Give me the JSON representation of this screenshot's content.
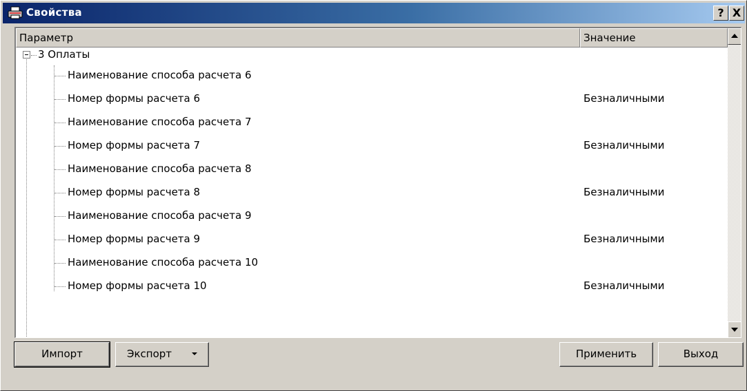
{
  "window": {
    "title": "Свойства",
    "help_label": "?",
    "close_label": "X"
  },
  "table": {
    "columns": [
      "Параметр",
      "Значение"
    ],
    "group": {
      "label": "3 Оплаты",
      "expanded": true
    },
    "rows": [
      {
        "label": "Наименование способа расчета 6",
        "value": ""
      },
      {
        "label": "Номер формы расчета 6",
        "value": "Безналичными"
      },
      {
        "label": "Наименование способа расчета 7",
        "value": ""
      },
      {
        "label": "Номер формы расчета 7",
        "value": "Безналичными"
      },
      {
        "label": "Наименование способа расчета 8",
        "value": ""
      },
      {
        "label": "Номер формы расчета 8",
        "value": "Безналичными"
      },
      {
        "label": "Наименование способа расчета 9",
        "value": ""
      },
      {
        "label": "Номер формы расчета 9",
        "value": "Безналичными"
      },
      {
        "label": "Наименование способа расчета 10",
        "value": ""
      },
      {
        "label": "Номер формы расчета 10",
        "value": "Безналичными"
      }
    ]
  },
  "buttons": {
    "import": "Импорт",
    "export": "Экспорт",
    "apply": "Применить",
    "exit": "Выход"
  },
  "colors": {
    "title_gradient_start": "#0a246a",
    "title_gradient_end": "#a6caf0",
    "face": "#d4d0c8"
  },
  "icons": {
    "title": "printer-icon",
    "expander": "tree-collapse-icon",
    "export_dropdown": "dropdown-arrow-icon"
  }
}
